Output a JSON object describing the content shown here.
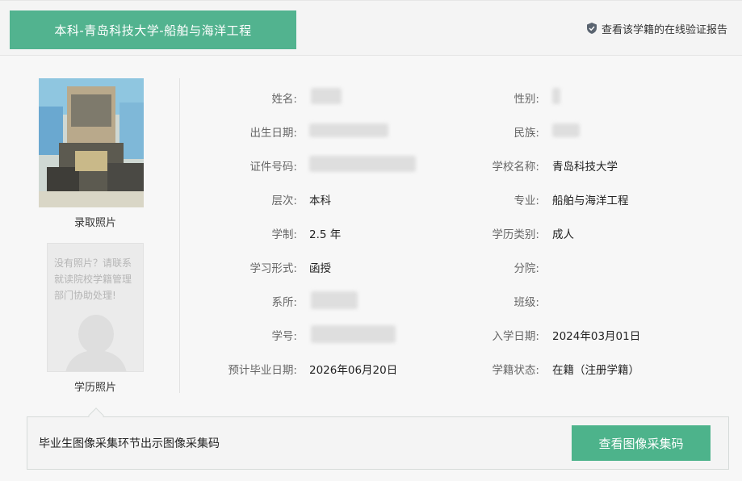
{
  "header": {
    "title": "本科-青岛科技大学-船舶与海洋工程",
    "verify_link": "查看该学籍的在线验证报告",
    "verify_icon": "shield-icon"
  },
  "photos": {
    "admission_photo_label": "录取照片",
    "degree_photo_label": "学历照片",
    "degree_photo_placeholder": "没有照片？请联系就读院校学籍管理部门协助处理!"
  },
  "fields": {
    "name_label": "姓名:",
    "gender_label": "性别:",
    "birth_label": "出生日期:",
    "ethnicity_label": "民族:",
    "id_label": "证件号码:",
    "school_label": "学校名称:",
    "school_value": "青岛科技大学",
    "level_label": "层次:",
    "level_value": "本科",
    "major_label": "专业:",
    "major_value": "船舶与海洋工程",
    "duration_label": "学制:",
    "duration_value": "2.5 年",
    "edu_type_label": "学历类别:",
    "edu_type_value": "成人",
    "study_form_label": "学习形式:",
    "study_form_value": "函授",
    "branch_label": "分院:",
    "branch_value": "",
    "dept_label": "系所:",
    "class_label": "班级:",
    "class_value": "",
    "student_no_label": "学号:",
    "enroll_date_label": "入学日期:",
    "enroll_date_value": "2024年03月01日",
    "grad_date_label": "预计毕业日期:",
    "grad_date_value": "2026年06月20日",
    "status_label": "学籍状态:",
    "status_value": "在籍（注册学籍）"
  },
  "bottom": {
    "notice": "毕业生图像采集环节出示图像采集码",
    "button_label": "查看图像采集码"
  },
  "colors": {
    "accent": "#52b38f",
    "button": "#4db38b"
  }
}
